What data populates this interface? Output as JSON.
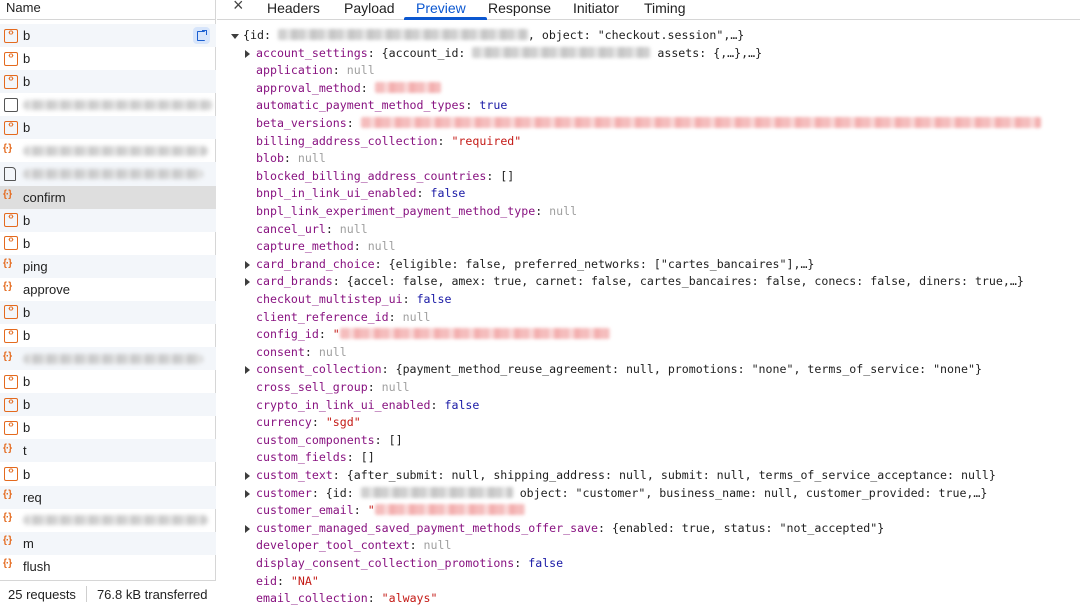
{
  "left_panel": {
    "header": "Name",
    "requests": [
      {
        "name": "b",
        "icon": "fetch-icon",
        "selected": false,
        "alt": true,
        "action": true
      },
      {
        "name": "b",
        "icon": "fetch-icon",
        "selected": false,
        "alt": false
      },
      {
        "name": "b",
        "icon": "fetch-icon",
        "selected": false,
        "alt": true
      },
      {
        "name": "",
        "icon": "checkbox-icon",
        "blurred": 190,
        "selected": false,
        "alt": false
      },
      {
        "name": "b",
        "icon": "fetch-icon",
        "selected": false,
        "alt": true
      },
      {
        "name": "",
        "icon": "json-icon",
        "blurred": 185,
        "selected": false,
        "alt": false
      },
      {
        "name": "",
        "icon": "document-icon",
        "blurred": 180,
        "selected": false,
        "alt": true
      },
      {
        "name": "confirm",
        "icon": "json-icon",
        "selected": true,
        "alt": false
      },
      {
        "name": "b",
        "icon": "fetch-icon",
        "selected": false,
        "alt": true
      },
      {
        "name": "b",
        "icon": "fetch-icon",
        "selected": false,
        "alt": false
      },
      {
        "name": "ping",
        "icon": "json-icon",
        "selected": false,
        "alt": true
      },
      {
        "name": "approve",
        "icon": "json-icon",
        "selected": false,
        "alt": false
      },
      {
        "name": "b",
        "icon": "fetch-icon",
        "selected": false,
        "alt": true
      },
      {
        "name": "b",
        "icon": "fetch-icon",
        "selected": false,
        "alt": false
      },
      {
        "name": "",
        "icon": "json-icon",
        "blurred": 180,
        "selected": false,
        "alt": true
      },
      {
        "name": "b",
        "icon": "fetch-icon",
        "selected": false,
        "alt": false
      },
      {
        "name": "b",
        "icon": "fetch-icon",
        "selected": false,
        "alt": true
      },
      {
        "name": "b",
        "icon": "fetch-icon",
        "selected": false,
        "alt": false
      },
      {
        "name": "t",
        "icon": "json-icon",
        "selected": false,
        "alt": true
      },
      {
        "name": "b",
        "icon": "fetch-icon",
        "selected": false,
        "alt": false
      },
      {
        "name": "req",
        "icon": "json-icon",
        "selected": false,
        "alt": true
      },
      {
        "name": "",
        "icon": "json-icon",
        "blurred": 185,
        "selected": false,
        "alt": false
      },
      {
        "name": "m",
        "icon": "json-icon",
        "selected": false,
        "alt": true
      },
      {
        "name": "flush",
        "icon": "json-icon",
        "selected": false,
        "alt": false
      }
    ],
    "status": {
      "requests": "25 requests",
      "transferred": "76.8 kB transferred"
    }
  },
  "tabs": {
    "close_icon": "close-icon",
    "items": [
      "Headers",
      "Payload",
      "Preview",
      "Response",
      "Initiator",
      "Timing"
    ],
    "active": "Preview"
  },
  "preview": {
    "lines": [
      {
        "expander": "down",
        "indent": 0,
        "segs": [
          [
            "p",
            "{id: "
          ],
          [
            "rg",
            ""
          ],
          [
            "p",
            ", object: \"checkout.session\",…}"
          ]
        ]
      },
      {
        "expander": "right",
        "segs": [
          [
            "k",
            "account_settings"
          ],
          [
            "p",
            ": {account_id: "
          ],
          [
            "rg",
            ""
          ],
          [
            "p",
            " assets: {,…},…}"
          ]
        ]
      },
      {
        "segs": [
          [
            "k",
            "application"
          ],
          [
            "p",
            ": "
          ],
          [
            "n",
            "null"
          ]
        ]
      },
      {
        "segs": [
          [
            "k",
            "approval_method"
          ],
          [
            "p",
            ": "
          ],
          [
            "r",
            ""
          ]
        ]
      },
      {
        "segs": [
          [
            "k",
            "automatic_payment_method_types"
          ],
          [
            "p",
            ": "
          ],
          [
            "b",
            "true"
          ]
        ]
      },
      {
        "segs": [
          [
            "k",
            "beta_versions"
          ],
          [
            "p",
            ": "
          ],
          [
            "r",
            ""
          ]
        ]
      },
      {
        "segs": [
          [
            "k",
            "billing_address_collection"
          ],
          [
            "p",
            ": "
          ],
          [
            "s",
            "\"required\""
          ]
        ]
      },
      {
        "segs": [
          [
            "k",
            "blob"
          ],
          [
            "p",
            ": "
          ],
          [
            "n",
            "null"
          ]
        ]
      },
      {
        "segs": [
          [
            "k",
            "blocked_billing_address_countries"
          ],
          [
            "p",
            ": []"
          ]
        ]
      },
      {
        "segs": [
          [
            "k",
            "bnpl_in_link_ui_enabled"
          ],
          [
            "p",
            ": "
          ],
          [
            "b",
            "false"
          ]
        ]
      },
      {
        "segs": [
          [
            "k",
            "bnpl_link_experiment_payment_method_type"
          ],
          [
            "p",
            ": "
          ],
          [
            "n",
            "null"
          ]
        ]
      },
      {
        "segs": [
          [
            "k",
            "cancel_url"
          ],
          [
            "p",
            ": "
          ],
          [
            "n",
            "null"
          ]
        ]
      },
      {
        "segs": [
          [
            "k",
            "capture_method"
          ],
          [
            "p",
            ": "
          ],
          [
            "n",
            "null"
          ]
        ]
      },
      {
        "expander": "right",
        "segs": [
          [
            "k",
            "card_brand_choice"
          ],
          [
            "p",
            ": {eligible: false, preferred_networks: [\"cartes_bancaires\"],…}"
          ]
        ]
      },
      {
        "expander": "right",
        "segs": [
          [
            "k",
            "card_brands"
          ],
          [
            "p",
            ": {accel: false, amex: true, carnet: false, cartes_bancaires: false, conecs: false, diners: true,…}"
          ]
        ]
      },
      {
        "segs": [
          [
            "k",
            "checkout_multistep_ui"
          ],
          [
            "p",
            ": "
          ],
          [
            "b",
            "false"
          ]
        ]
      },
      {
        "segs": [
          [
            "k",
            "client_reference_id"
          ],
          [
            "p",
            ": "
          ],
          [
            "n",
            "null"
          ]
        ]
      },
      {
        "segs": [
          [
            "k",
            "config_id"
          ],
          [
            "p",
            ": "
          ],
          [
            "s",
            "\""
          ],
          [
            "r",
            ""
          ]
        ]
      },
      {
        "segs": [
          [
            "k",
            "consent"
          ],
          [
            "p",
            ": "
          ],
          [
            "n",
            "null"
          ]
        ]
      },
      {
        "expander": "right",
        "segs": [
          [
            "k",
            "consent_collection"
          ],
          [
            "p",
            ": {payment_method_reuse_agreement: null, promotions: \"none\", terms_of_service: \"none\"}"
          ]
        ]
      },
      {
        "segs": [
          [
            "k",
            "cross_sell_group"
          ],
          [
            "p",
            ": "
          ],
          [
            "n",
            "null"
          ]
        ]
      },
      {
        "segs": [
          [
            "k",
            "crypto_in_link_ui_enabled"
          ],
          [
            "p",
            ": "
          ],
          [
            "b",
            "false"
          ]
        ]
      },
      {
        "segs": [
          [
            "k",
            "currency"
          ],
          [
            "p",
            ": "
          ],
          [
            "s",
            "\"sgd\""
          ]
        ]
      },
      {
        "segs": [
          [
            "k",
            "custom_components"
          ],
          [
            "p",
            ": []"
          ]
        ]
      },
      {
        "segs": [
          [
            "k",
            "custom_fields"
          ],
          [
            "p",
            ": []"
          ]
        ]
      },
      {
        "expander": "right",
        "segs": [
          [
            "k",
            "custom_text"
          ],
          [
            "p",
            ": {after_submit: null, shipping_address: null, submit: null, terms_of_service_acceptance: null}"
          ]
        ]
      },
      {
        "expander": "right",
        "segs": [
          [
            "k",
            "customer"
          ],
          [
            "p",
            ": {id: "
          ],
          [
            "rg",
            ""
          ],
          [
            "p",
            " object: \"customer\", business_name: null, customer_provided: true,…}"
          ]
        ]
      },
      {
        "segs": [
          [
            "k",
            "customer_email"
          ],
          [
            "p",
            ": "
          ],
          [
            "s",
            "\""
          ],
          [
            "r",
            ""
          ]
        ]
      },
      {
        "expander": "right",
        "segs": [
          [
            "k",
            "customer_managed_saved_payment_methods_offer_save"
          ],
          [
            "p",
            ": {enabled: true, status: \"not_accepted\"}"
          ]
        ]
      },
      {
        "segs": [
          [
            "k",
            "developer_tool_context"
          ],
          [
            "p",
            ": "
          ],
          [
            "n",
            "null"
          ]
        ]
      },
      {
        "segs": [
          [
            "k",
            "display_consent_collection_promotions"
          ],
          [
            "p",
            ": "
          ],
          [
            "b",
            "false"
          ]
        ]
      },
      {
        "segs": [
          [
            "k",
            "eid"
          ],
          [
            "p",
            ": "
          ],
          [
            "s",
            "\"NA\""
          ]
        ]
      },
      {
        "segs": [
          [
            "k",
            "email_collection"
          ],
          [
            "p",
            ": "
          ],
          [
            "s",
            "\"always\""
          ]
        ]
      }
    ]
  }
}
